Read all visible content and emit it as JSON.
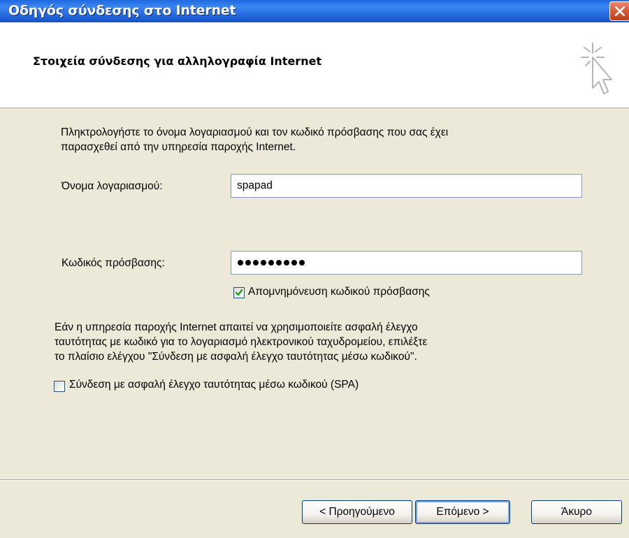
{
  "window": {
    "title": "Οδηγός σύνδεσης στο Internet",
    "close_icon": "close-icon"
  },
  "header": {
    "title": "Στοιχεία σύνδεσης για αλληλογραφία Internet",
    "icon": "wizard-cursor-icon"
  },
  "body": {
    "intro_line1": "Πληκτρολογήστε το όνομα λογαριασμού και τον κωδικό πρόσβασης που σας έχει",
    "intro_line2": "παρασχεθεί από την υπηρεσία παροχής Internet.",
    "account_label": "Όνομα λογαριασμού:",
    "account_value": "spapad",
    "password_label": "Κωδικός πρόσβασης:",
    "password_masked": "•••••••••",
    "remember_label": "Απομνημόνευση κωδικού πρόσβασης",
    "remember_checked": true,
    "spa_desc_line1": "Εάν η υπηρεσία παροχής Internet απαιτεί να χρησιμοποιείτε ασφαλή έλεγχο",
    "spa_desc_line2": "ταυτότητας με κωδικό για το λογαριασμό ηλεκτρονικού ταχυδρομείου, επιλέξτε",
    "spa_desc_line3": "το πλαίσιο ελέγχου \"Σύνδεση με ασφαλή έλεγχο ταυτότητας μέσω κωδικού\".",
    "spa_label": "Σύνδεση με ασφαλή έλεγχο ταυτότητας μέσω κωδικού (SPA)",
    "spa_checked": false
  },
  "buttons": {
    "back": "< Προηγούμενο",
    "next": "Επόμενο >",
    "cancel": "Άκυρο"
  },
  "colors": {
    "titlebar": "#2467dc",
    "dialog_bg": "#ece9d8",
    "check_green": "#21a121"
  }
}
